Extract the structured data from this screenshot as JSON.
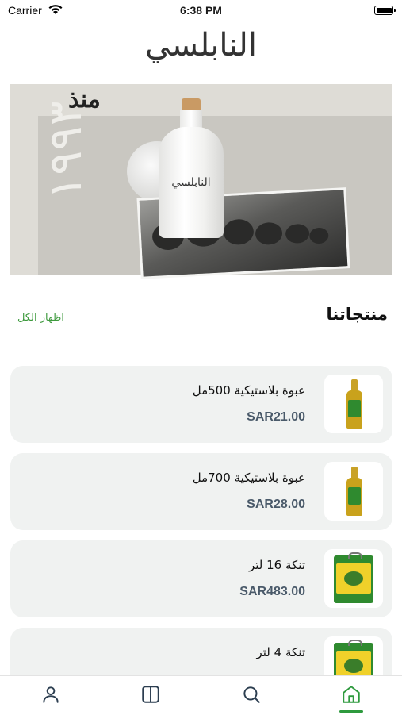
{
  "status_bar": {
    "carrier": "Carrier",
    "time": "6:38 PM"
  },
  "header": {
    "logo_text": "النابلسي"
  },
  "banner": {
    "since": "منذ",
    "year": "١٩٩٣",
    "bottle_label": "النابلسي"
  },
  "section": {
    "title": "منتجاتنا",
    "show_all": "اظهار الكل"
  },
  "products": [
    {
      "name": "عبوة بلاستيكية 500مل",
      "price": "SAR21.00",
      "image": "oil-bottle"
    },
    {
      "name": "عبوة بلاستيكية 700مل",
      "price": "SAR28.00",
      "image": "oil-bottle"
    },
    {
      "name": "تنكة 16 لتر",
      "price": "SAR483.00",
      "image": "oil-tin"
    },
    {
      "name": "تنكة 4 لتر",
      "price": "",
      "image": "oil-tin"
    }
  ],
  "tabbar": {
    "tabs": [
      {
        "icon": "profile-icon"
      },
      {
        "icon": "categories-icon"
      },
      {
        "icon": "search-icon"
      },
      {
        "icon": "home-icon",
        "active": true
      }
    ],
    "active_color": "#2e9a3e",
    "inactive_color": "#2c3e50"
  },
  "colors": {
    "accent": "#3e9a3e",
    "price": "#4a5a6a",
    "card_bg": "#f0f2f1"
  }
}
